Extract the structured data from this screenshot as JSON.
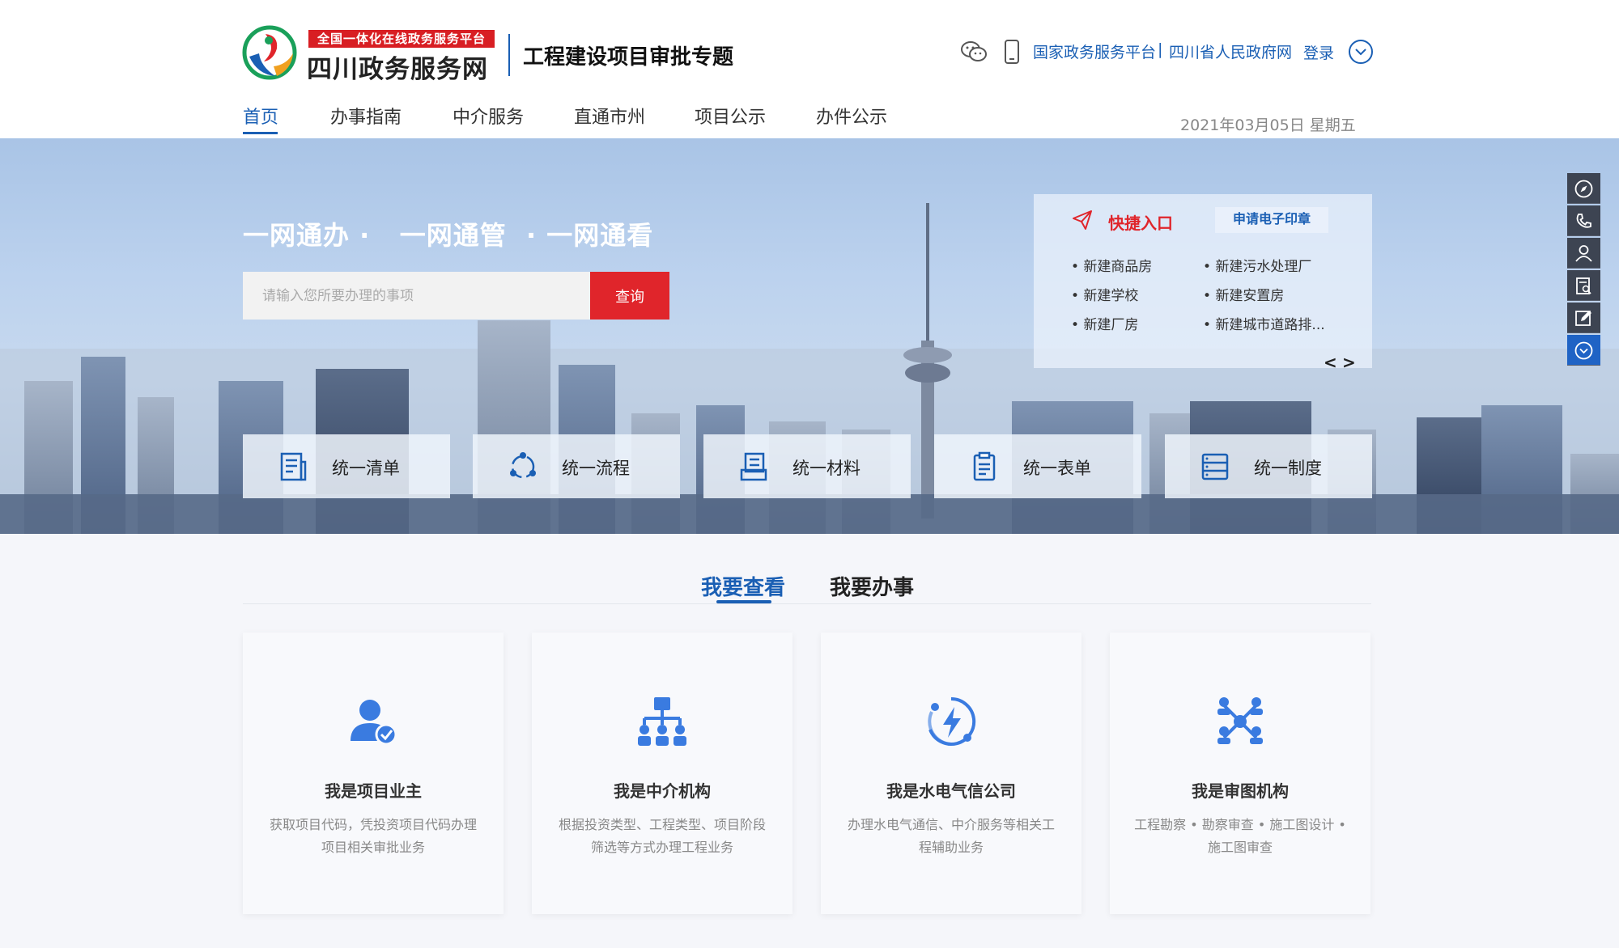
{
  "header": {
    "logo_ribbon": "全国一体化在线政务服务平台",
    "logo_name": "四川政务服务网",
    "site_title": "工程建设项目审批专题",
    "national_link": "国家政务服务平台",
    "link_separator": "|",
    "province_link": "四川省人民政府网",
    "login": "登录",
    "date": "2021年03月05日 星期五"
  },
  "nav": {
    "items": [
      {
        "label": "首页",
        "active": true
      },
      {
        "label": "办事指南"
      },
      {
        "label": "中介服务"
      },
      {
        "label": "直通市州"
      },
      {
        "label": "项目公示"
      },
      {
        "label": "办件公示"
      }
    ]
  },
  "hero": {
    "slogan": "一网通办 ·   一网通管  · 一网通看",
    "search_placeholder": "请输入您所要办理的事项",
    "search_button": "查询"
  },
  "quick_entry": {
    "title": "快捷入口",
    "seal_button": "申请电子印章",
    "items": [
      "新建商品房",
      "新建污水处理厂",
      "新建学校",
      "新建安置房",
      "新建厂房",
      "新建城市道路排..."
    ],
    "prev": "<",
    "next": ">"
  },
  "features": [
    {
      "label": "统一清单",
      "icon": "list-document-icon"
    },
    {
      "label": "统一流程",
      "icon": "process-cycle-icon"
    },
    {
      "label": "统一材料",
      "icon": "materials-stack-icon"
    },
    {
      "label": "统一表单",
      "icon": "clipboard-form-icon"
    },
    {
      "label": "统一制度",
      "icon": "regulation-list-icon"
    }
  ],
  "side_toolbar": [
    "compass-icon",
    "phone-icon",
    "user-icon",
    "document-search-icon",
    "edit-icon",
    "chevron-down-icon"
  ],
  "tabs": {
    "view": "我要查看",
    "do": "我要办事"
  },
  "roles": [
    {
      "title": "我是项目业主",
      "desc": "获取项目代码，凭投资项目代码办理项目相关审批业务",
      "icon": "owner-verified-icon"
    },
    {
      "title": "我是中介机构",
      "desc": "根据投资类型、工程类型、项目阶段筛选等方式办理工程业务",
      "icon": "org-chart-icon"
    },
    {
      "title": "我是水电气信公司",
      "desc": "办理水电气通信、中介服务等相关工程辅助业务",
      "icon": "utility-power-icon"
    },
    {
      "title": "我是审图机构",
      "desc": "工程勘察 • 勘察审查 • 施工图设计 • 施工图审查",
      "icon": "network-review-icon"
    }
  ],
  "colors": {
    "brand_blue": "#1a5fb4",
    "accent_red": "#e0252b",
    "icon_blue": "#3a7be0",
    "toolbar_dark": "#3d4452"
  }
}
